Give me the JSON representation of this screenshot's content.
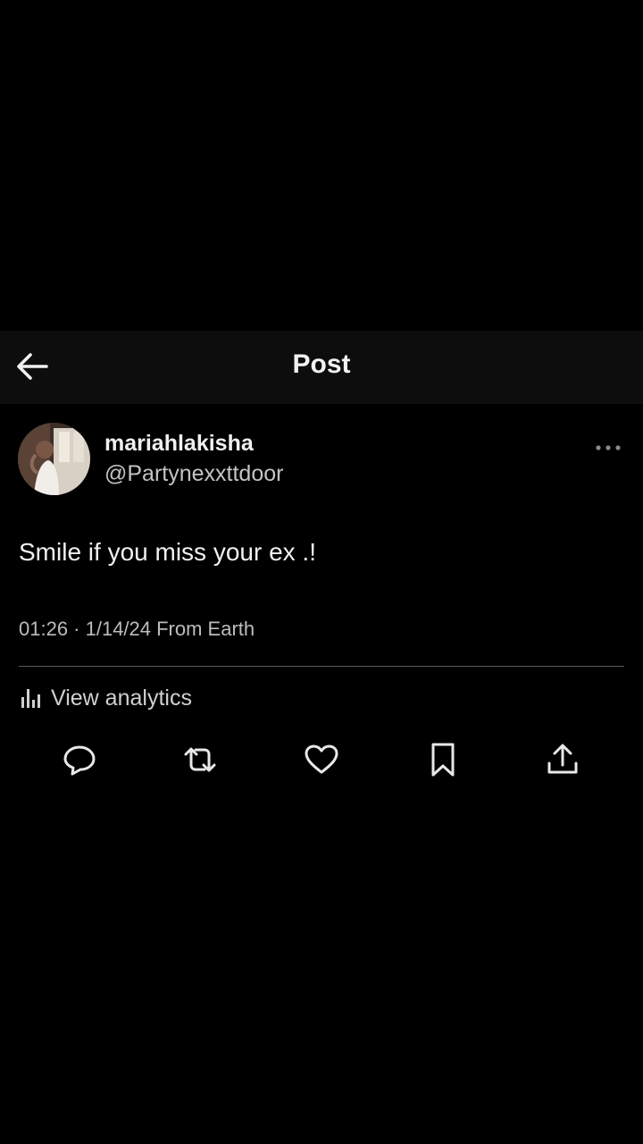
{
  "header": {
    "title": "Post",
    "back_icon": "arrow-left-icon"
  },
  "post": {
    "author": {
      "display_name": "mariahlakisha",
      "handle": "@Partynexxttdoor"
    },
    "text": "Smile if you miss your ex .!",
    "meta": "01:26 · 1/14/24 From Earth",
    "analytics_label": "View analytics",
    "more_icon": "more-dots-icon"
  },
  "actions": [
    {
      "name": "reply",
      "icon": "reply-icon"
    },
    {
      "name": "repost",
      "icon": "repost-icon"
    },
    {
      "name": "like",
      "icon": "heart-icon"
    },
    {
      "name": "bookmark",
      "icon": "bookmark-icon"
    },
    {
      "name": "share",
      "icon": "share-icon"
    }
  ],
  "colors": {
    "background": "#000000",
    "header_background": "#0d0d0d",
    "text_primary": "#f0f0f0",
    "text_secondary": "#bcbcbc",
    "divider": "#5a5a5a"
  }
}
